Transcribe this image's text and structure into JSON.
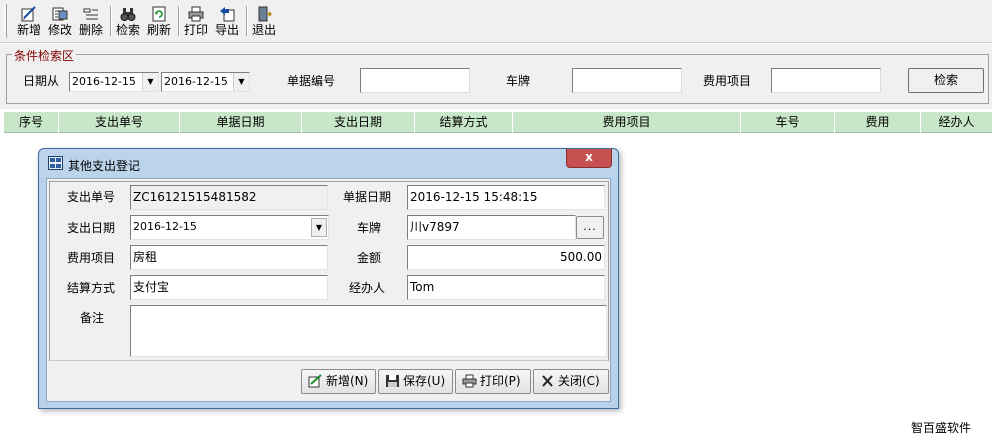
{
  "toolbar": {
    "new_label": "新增",
    "edit_label": "修改",
    "delete_label": "删除",
    "search_label": "检索",
    "refresh_label": "刷新",
    "print_label": "打印",
    "export_label": "导出",
    "exit_label": "退出",
    "icons": {
      "new": "new-entry-icon",
      "edit": "edit-icon",
      "delete": "delete-icon",
      "search": "binoculars-icon",
      "refresh": "refresh-icon",
      "print": "printer-icon",
      "export": "export-icon",
      "exit": "exit-door-icon"
    }
  },
  "search": {
    "group_title": "条件检索区",
    "date_from_label": "日期从",
    "date_from_value": "2016-12-15",
    "date_to_value": "2016-12-15",
    "doc_no_label": "单据编号",
    "doc_no_value": "",
    "plate_label": "车牌",
    "plate_value": "",
    "expense_item_label": "费用项目",
    "expense_item_value": "",
    "search_button": "检索"
  },
  "grid": {
    "columns": [
      "序号",
      "支出单号",
      "单据日期",
      "支出日期",
      "结算方式",
      "费用项目",
      "车号",
      "费用",
      "经办人"
    ],
    "rows": []
  },
  "dialog": {
    "title": "其他支出登记",
    "close_label": "x",
    "expense_no_label": "支出单号",
    "expense_no_value": "ZC16121515481582",
    "doc_date_label": "单据日期",
    "doc_date_value": "2016-12-15 15:48:15",
    "expense_date_label": "支出日期",
    "expense_date_value": "2016-12-15",
    "plate_label": "车牌",
    "plate_value": "川v7897",
    "expense_item_label": "费用项目",
    "expense_item_value": "房租",
    "amount_label": "金额",
    "amount_value": "500.00",
    "settlement_label": "结算方式",
    "settlement_value": "支付宝",
    "handler_label": "经办人",
    "handler_value": "Tom",
    "remark_label": "备注",
    "remark_value": "",
    "browse_label": "...",
    "buttons": {
      "new": "新增(N)",
      "save": "保存(U)",
      "print": "打印(P)",
      "close": "关闭(C)"
    }
  },
  "footer": {
    "brand": "智百盛软件"
  },
  "colors": {
    "grid_header_bg": "#c8e6c8",
    "group_title": "#800000",
    "dialog_frame": "#b9d1ea",
    "close_button": "#c75050"
  }
}
